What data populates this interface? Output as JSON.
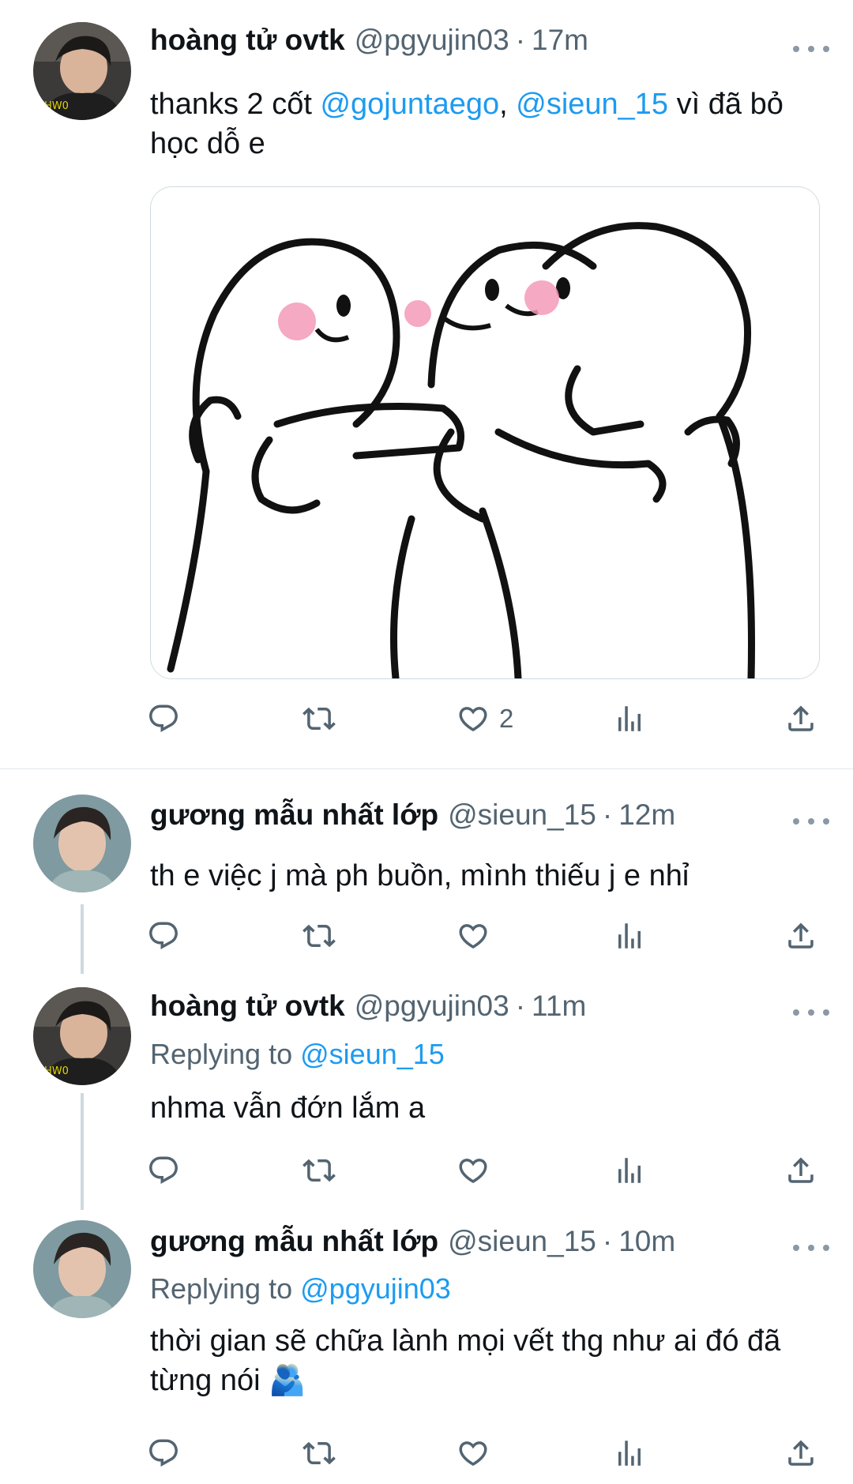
{
  "tweets": [
    {
      "name": "hoàng tử ovtk",
      "handle": "@pgyujin03",
      "time": "17m",
      "text_parts": [
        "thanks 2 cốt ",
        "@gojuntaego",
        ", ",
        "@sieun_15",
        " vì đã bỏ học dỗ e"
      ],
      "has_media": true,
      "media_description": "hug sticker",
      "likes": "2"
    },
    {
      "name": "gương mẫu nhất lớp",
      "handle": "@sieun_15",
      "time": "12m",
      "text": "th e việc j mà ph buồn, mình thiếu j e nhỉ"
    },
    {
      "name": "hoàng tử ovtk",
      "handle": "@pgyujin03",
      "time": "11m",
      "replying_label": "Replying to",
      "replying_to": "@sieun_15",
      "text": "nhma vẫn đớn lắm a"
    },
    {
      "name": "gương mẫu nhất lớp",
      "handle": "@sieun_15",
      "time": "10m",
      "replying_label": "Replying to",
      "replying_to": "@pgyujin03",
      "text": "thời gian sẽ chữa lành mọi vết thg như ai đó đã từng nói 🫂"
    }
  ],
  "icons": {
    "reply": "reply-icon",
    "retweet": "retweet-icon",
    "like": "heart-icon",
    "views": "views-icon",
    "share": "share-icon",
    "more": "more-icon"
  },
  "colors": {
    "link": "#1d9bf0",
    "secondary": "#536471",
    "icon": "#536471",
    "blush": "#f39ab7"
  }
}
